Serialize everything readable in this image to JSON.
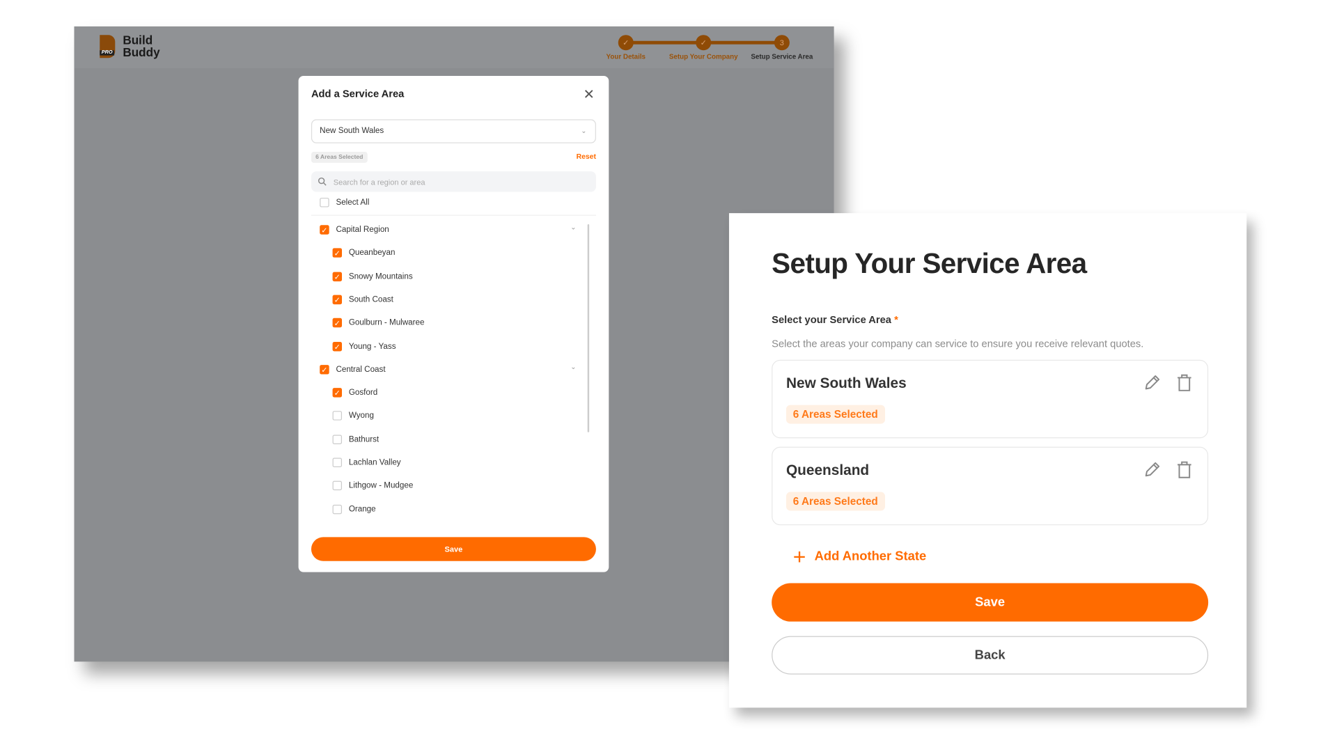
{
  "colors": {
    "accent": "#ff6b00",
    "step_complete": "#8f4b06",
    "overlay": "#8b8d90"
  },
  "logo": {
    "line1": "Build",
    "line2": "Buddy",
    "badge": "PRO"
  },
  "stepper": {
    "steps": [
      {
        "label": "Your Details",
        "state": "complete",
        "marker": "✓"
      },
      {
        "label": "Setup Your Company",
        "state": "complete",
        "marker": "✓"
      },
      {
        "label": "Setup Service Area",
        "state": "current",
        "marker": "3"
      }
    ]
  },
  "modal": {
    "title": "Add a Service Area",
    "close_icon": "close-icon",
    "state_select": "New South Wales",
    "selected_count": "6 Areas Selected",
    "reset_label": "Reset",
    "search_placeholder": "Search for a region or area",
    "select_all_label": "Select All",
    "select_all_checked": false,
    "regions": [
      {
        "label": "Capital Region",
        "checked": true,
        "children": [
          {
            "label": "Queanbeyan",
            "checked": true
          },
          {
            "label": "Snowy Mountains",
            "checked": true
          },
          {
            "label": "South Coast",
            "checked": true
          },
          {
            "label": "Goulburn - Mulwaree",
            "checked": true
          },
          {
            "label": "Young - Yass",
            "checked": true
          }
        ]
      },
      {
        "label": "Central Coast",
        "checked": true,
        "children": [
          {
            "label": "Gosford",
            "checked": true
          },
          {
            "label": "Wyong",
            "checked": false
          },
          {
            "label": "Bathurst",
            "checked": false
          },
          {
            "label": "Lachlan Valley",
            "checked": false
          },
          {
            "label": "Lithgow - Mudgee",
            "checked": false
          },
          {
            "label": "Orange",
            "checked": false
          }
        ]
      }
    ],
    "save_label": "Save"
  },
  "card": {
    "title": "Setup Your Service Area",
    "field_label": "Select your Service Area",
    "required_mark": "*",
    "description": "Select the areas your company can service to ensure you receive relevant quotes.",
    "states": [
      {
        "name": "New South Wales",
        "badge": "6 Areas Selected"
      },
      {
        "name": "Queensland",
        "badge": "6 Areas Selected"
      }
    ],
    "add_label": "Add Another State",
    "save_label": "Save",
    "back_label": "Back"
  }
}
